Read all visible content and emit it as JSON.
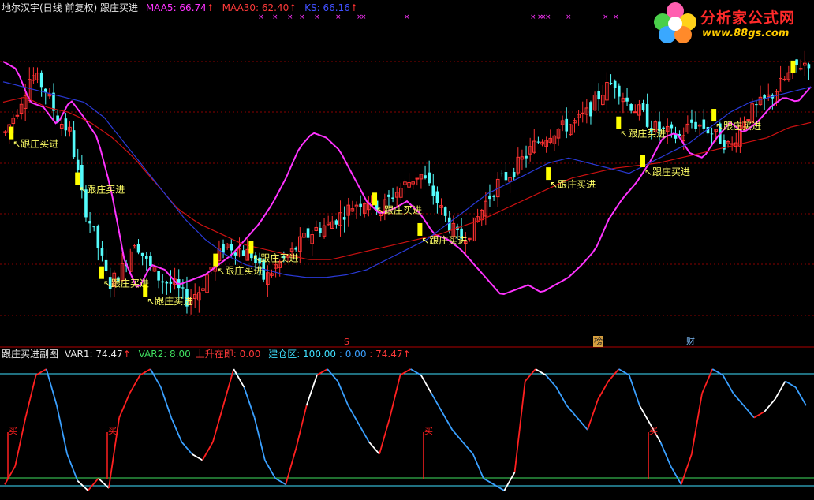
{
  "header_main": {
    "title": "地尔汉宇(日线 前复权) 跟庄买进",
    "maa5_label": "MAA5: 66.74",
    "maa30_label": "MAA30: 62.40",
    "ks_label": "KS: 66.16",
    "arrow": "↑"
  },
  "header_sub": {
    "title": "跟庄买进副图",
    "var1_label": "VAR1: 74.47",
    "var2_label": "VAR2: 8.00",
    "rise_label": "上升在即: 0.00",
    "build_label": "建仓区: 100.00",
    "extra1": ": 0.00",
    "extra2": ": 74.47",
    "arrow": "↑"
  },
  "logo": {
    "title": "分析家公式网",
    "url": "www.88gs.com"
  },
  "colors": {
    "up": "#ff3232",
    "down": "#54fcfc",
    "maa5": "#ff33ff",
    "maa30": "#cc1111",
    "ks": "#2a3ad8",
    "signal": "#ffff00",
    "label": "#ffff66",
    "grid": "#8a0000",
    "sub_up": "#ff2020",
    "sub_down": "#3aa0ff",
    "sub_white": "#ffffff",
    "sub_hline": "#40e0ff"
  },
  "marker_labels": {
    "s": "S",
    "bang": "榜",
    "cai": "财"
  },
  "chart_data": [
    {
      "type": "candlestick",
      "signal_label": "跟庄买进",
      "series": [
        {
          "name": "MAA5",
          "color": "#ff33ff",
          "y_path": [
            1.0,
            0.97,
            0.84,
            0.82,
            0.75,
            0.85,
            0.78,
            0.7,
            0.5,
            0.22,
            0.1,
            0.2,
            0.18,
            0.12,
            0.14,
            0.16,
            0.2,
            0.24,
            0.3,
            0.36,
            0.44,
            0.54,
            0.66,
            0.72,
            0.7,
            0.65,
            0.55,
            0.45,
            0.4,
            0.42,
            0.45,
            0.4,
            0.32,
            0.3,
            0.26,
            0.2,
            0.14,
            0.08,
            0.1,
            0.12,
            0.09,
            0.12,
            0.15,
            0.2,
            0.26,
            0.38,
            0.46,
            0.52,
            0.6,
            0.7,
            0.72,
            0.64,
            0.62,
            0.7,
            0.76,
            0.72,
            0.76,
            0.82,
            0.86,
            0.84,
            0.9
          ]
        },
        {
          "name": "MAA30",
          "color": "#cc1111",
          "y_path": [
            0.84,
            0.86,
            0.82,
            0.8,
            0.76,
            0.7,
            0.62,
            0.52,
            0.42,
            0.36,
            0.32,
            0.28,
            0.26,
            0.24,
            0.22,
            0.22,
            0.24,
            0.26,
            0.28,
            0.3,
            0.32,
            0.35,
            0.38,
            0.42,
            0.46,
            0.5,
            0.54,
            0.56,
            0.58,
            0.59,
            0.6,
            0.62,
            0.64,
            0.66,
            0.68,
            0.7,
            0.74,
            0.76
          ]
        },
        {
          "name": "KS",
          "color": "#2a3ad8",
          "y_path": [
            0.92,
            0.9,
            0.88,
            0.86,
            0.84,
            0.78,
            0.68,
            0.58,
            0.48,
            0.38,
            0.3,
            0.24,
            0.2,
            0.18,
            0.16,
            0.15,
            0.15,
            0.16,
            0.18,
            0.22,
            0.26,
            0.3,
            0.36,
            0.42,
            0.48,
            0.52,
            0.56,
            0.6,
            0.62,
            0.6,
            0.58,
            0.56,
            0.6,
            0.64,
            0.68,
            0.74,
            0.8,
            0.84,
            0.86,
            0.88,
            0.9
          ]
        }
      ]
    },
    {
      "type": "line",
      "series": [
        {
          "name": "VAR1"
        },
        {
          "name": "VAR2"
        }
      ],
      "annotations": [
        "买",
        "买",
        "买",
        "买"
      ],
      "levels": {
        "top": 100,
        "low_band": 8,
        "bottom": 0
      }
    }
  ]
}
